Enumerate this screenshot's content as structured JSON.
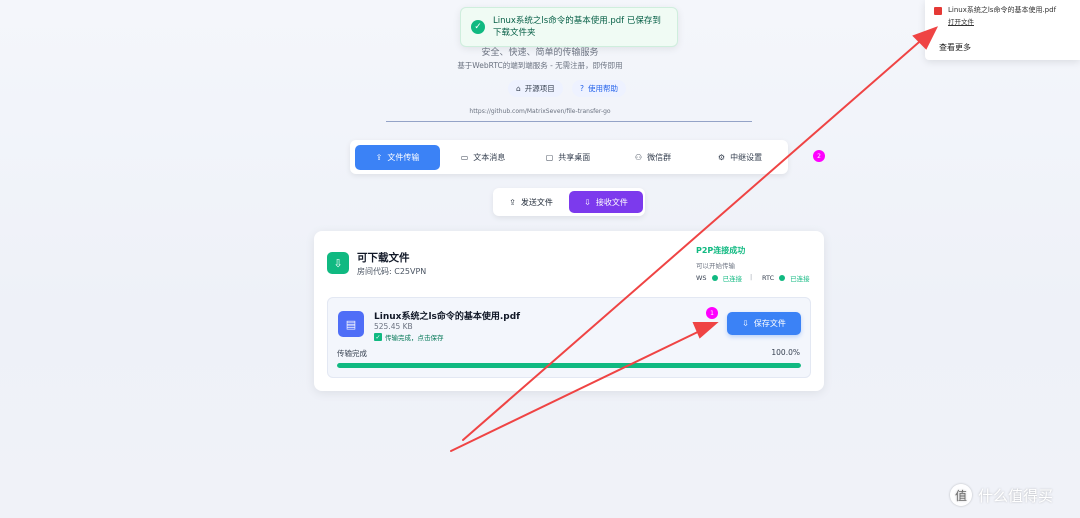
{
  "toast": {
    "message": "Linux系统之ls命令的基本使用.pdf 已保存到下载文件夹"
  },
  "download_popover": {
    "file_name": "Linux系统之ls命令的基本使用.pdf",
    "open_label": "打开文件",
    "more_label": "查看更多"
  },
  "header": {
    "tagline": "安全、快速、简单的传输服务",
    "description": "基于WebRTC的端到端服务 - 无需注册，即传即用",
    "open_source_label": "开源项目",
    "help_label": "使用帮助",
    "repo_url": "https://github.com/MatrixSeven/file-transfer-go"
  },
  "tabs": [
    {
      "label": "文件传输",
      "icon": "upload-icon",
      "active": true
    },
    {
      "label": "文本消息",
      "icon": "message-icon",
      "active": false
    },
    {
      "label": "共享桌面",
      "icon": "monitor-icon",
      "active": false
    },
    {
      "label": "微信群",
      "icon": "users-icon",
      "active": false
    },
    {
      "label": "中继设置",
      "icon": "gear-icon",
      "active": false
    }
  ],
  "annotation_badges": {
    "first": "1",
    "second": "2"
  },
  "mode_toggle": {
    "send_label": "发送文件",
    "receive_label": "接收文件",
    "active": "receive"
  },
  "card": {
    "title": "可下载文件",
    "room_code": "房间代码: C25VPN",
    "p2p_status": "P2P连接成功",
    "p2p_sub": "可以开始传输",
    "ws_label": "WS",
    "ws_status": "已连接",
    "rtc_label": "RTC",
    "rtc_status": "已连接",
    "separator": "|"
  },
  "file": {
    "name": "Linux系统之ls命令的基本使用.pdf",
    "size": "525.45 KB",
    "status": "传输完成，点击保存",
    "save_label": "保存文件",
    "progress_label": "传输完成",
    "progress_text": "100.0%",
    "progress_value": 1.0
  },
  "watermark": {
    "text": "什么值得买",
    "mark": "值"
  },
  "colors": {
    "primary": "#3b82f6",
    "purple": "#7c3aed",
    "success": "#10b981",
    "annotation_arrow": "#ef4444",
    "badge": "#ff00ff"
  }
}
